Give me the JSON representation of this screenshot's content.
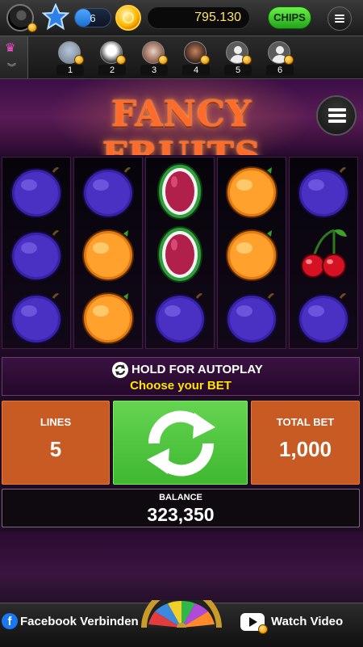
{
  "topbar": {
    "level": "6",
    "level_progress": 0.45,
    "balance": "795.130",
    "chips_label": "CHIPS"
  },
  "players": {
    "seats": [
      {
        "number": "1"
      },
      {
        "number": "2"
      },
      {
        "number": "3"
      },
      {
        "number": "4"
      },
      {
        "number": "5"
      },
      {
        "number": "6"
      }
    ]
  },
  "game": {
    "title": "FANCY FRUITS",
    "reels": [
      [
        "plum",
        "plum",
        "plum"
      ],
      [
        "plum",
        "orange",
        "orange"
      ],
      [
        "melon",
        "melon",
        "plum"
      ],
      [
        "orange",
        "orange",
        "plum"
      ],
      [
        "plum",
        "cherry",
        "plum"
      ]
    ]
  },
  "controls": {
    "hold_label": "HOLD FOR AUTOPLAY",
    "bet_prompt": "Choose your BET",
    "lines_label": "LINES",
    "lines_value": "5",
    "total_bet_label": "TOTAL BET",
    "total_bet_value": "1,000",
    "balance_label": "BALANCE",
    "balance_value": "323,350"
  },
  "bottombar": {
    "facebook_label": "Facebook Verbinden",
    "watch_label": "Watch Video"
  },
  "colors": {
    "spin_green": "#4cc23a",
    "panel_orange": "#c85a24",
    "title_orange": "#ff6b2a",
    "bet_yellow": "#ffe200",
    "background_purple": "#2a0b30"
  }
}
